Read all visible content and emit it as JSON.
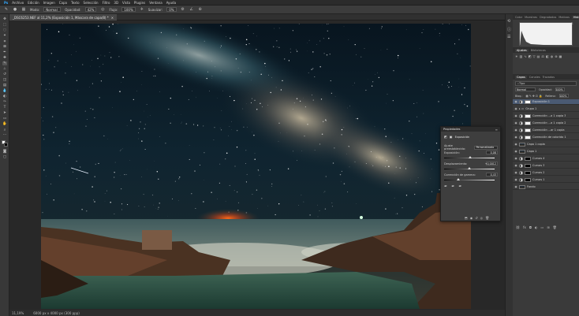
{
  "menu": [
    "Archivo",
    "Edición",
    "Imagen",
    "Capa",
    "Texto",
    "Selección",
    "Filtro",
    "3D",
    "Vista",
    "Plugins",
    "Ventana",
    "Ayuda"
  ],
  "options": {
    "mode_label": "Modo:",
    "mode_value": "Normal",
    "opacity_label": "Opacidad:",
    "opacity_value": "42%",
    "flow_label": "Flujo:",
    "flow_value": "100%",
    "smooth_label": "Suavizar:",
    "smooth_value": "0%"
  },
  "doc_tab": {
    "title": "_DSC6253.NEF al 11,2% (Exposición 1, Máscara de capa/8) *",
    "close": "×"
  },
  "status": {
    "zoom": "11,19%",
    "doc_info": "6000 px x 4000 px (300 ppp)"
  },
  "histogram_tabs": [
    "Color",
    "Muestras",
    "Degradados",
    "Motivos",
    "Histograma"
  ],
  "adjust_tabs": [
    "Ajustes",
    "Bibliotecas"
  ],
  "layers_tabs": [
    "Capas",
    "Canales",
    "Trazados"
  ],
  "layers_search": "Tipo",
  "blend_mode": "Normal",
  "opacity_label": "Opacidad:",
  "opacity_value": "100%",
  "lock_label": "Bloq.:",
  "fill_label": "Relleno:",
  "fill_value": "100%",
  "layers": [
    {
      "name": "Exposición 1",
      "kind": "adj",
      "mask": "white",
      "selected": true
    },
    {
      "name": "Grupo 1",
      "kind": "group",
      "mask": ""
    },
    {
      "name": "Corrección ...a 1 copia 3",
      "kind": "adj",
      "mask": "white"
    },
    {
      "name": "Corrección ...a 1 copia 2",
      "kind": "adj",
      "mask": "white"
    },
    {
      "name": "Corrección ...ar 1 copia",
      "kind": "adj",
      "mask": "white"
    },
    {
      "name": "Corrección de colorido 1",
      "kind": "adj",
      "mask": "white"
    },
    {
      "name": "Capa 1 copia",
      "kind": "img",
      "mask": ""
    },
    {
      "name": "Capa 1",
      "kind": "img",
      "mask": ""
    },
    {
      "name": "Curvas 4",
      "kind": "adj",
      "mask": "black"
    },
    {
      "name": "Curvas 3",
      "kind": "adj",
      "mask": "black"
    },
    {
      "name": "Curvas 2",
      "kind": "adj",
      "mask": "black"
    },
    {
      "name": "Curvas 1",
      "kind": "adj",
      "mask": "black"
    },
    {
      "name": "Fondo",
      "kind": "img",
      "mask": ""
    }
  ],
  "properties": {
    "title": "Propiedades",
    "subtitle": "Exposición",
    "preset_label": "Ajuste preestablecido:",
    "preset_value": "Personalizado",
    "rows": [
      {
        "label": "Exposición:",
        "value": "0,08",
        "knob": 0.51
      },
      {
        "label": "Desplazamiento:",
        "value": "+0,0012",
        "knob": 0.5
      },
      {
        "label": "Corrección de gamma:",
        "value": "0,43",
        "knob": 0.28
      }
    ]
  },
  "colors": {
    "accent": "#2f80ed",
    "panel": "#3a3a3a",
    "selected": "#4a5a73"
  }
}
